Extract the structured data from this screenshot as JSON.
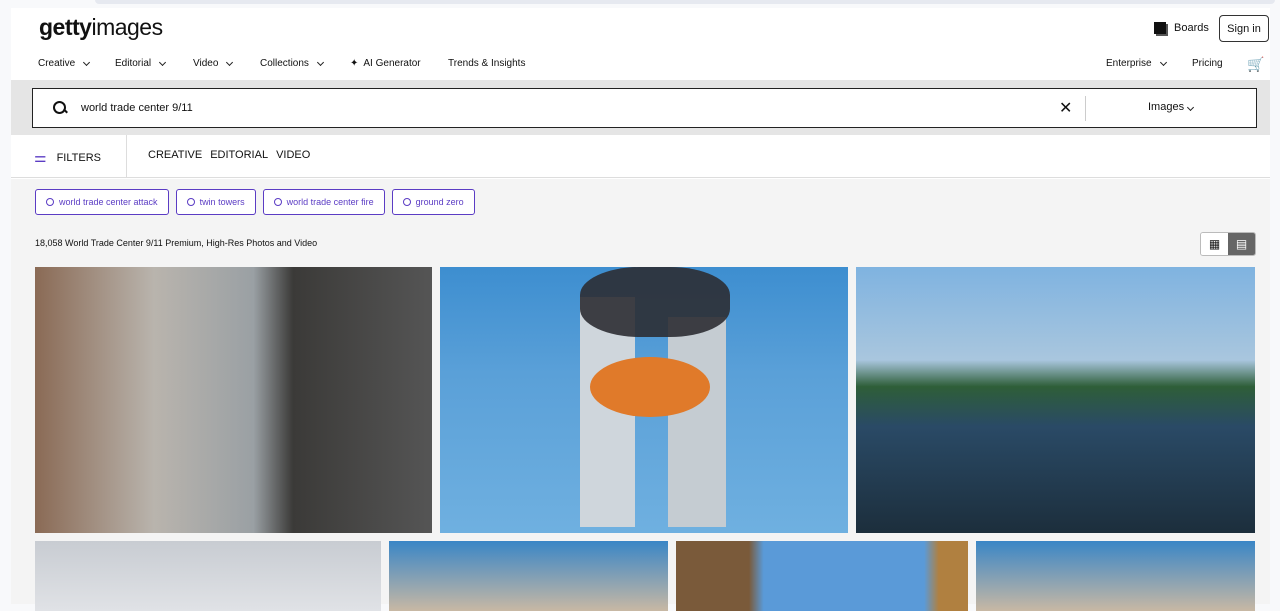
{
  "header": {
    "logo_bold": "getty",
    "logo_rest": "images",
    "boards": "Boards",
    "sign_in": "Sign in"
  },
  "nav": {
    "items": [
      "Creative",
      "Editorial",
      "Video",
      "Collections"
    ],
    "ai": "AI Generator",
    "trends": "Trends & Insights",
    "enterprise": "Enterprise",
    "pricing": "Pricing"
  },
  "search": {
    "value": "world trade center 9/11",
    "type": "Images"
  },
  "filters": {
    "label": "FILTERS",
    "tabs": [
      "CREATIVE",
      "EDITORIAL",
      "VIDEO"
    ]
  },
  "chips": [
    "world trade center attack",
    "twin towers",
    "world trade center fire",
    "ground zero"
  ],
  "results": {
    "count_text": "18,058 World Trade Center 9/11 Premium, High-Res Photos and Video"
  }
}
